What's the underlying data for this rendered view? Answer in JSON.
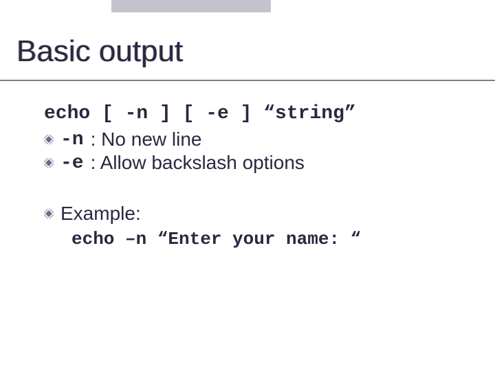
{
  "title": "Basic output",
  "syntax_line": "echo [ -n ] [ -e ] “string”",
  "bullets": [
    {
      "code": "-n",
      "text": ": No new line"
    },
    {
      "code": "-e",
      "text": ": Allow backslash options"
    }
  ],
  "example_label": "Example:",
  "example_code": "echo –n “Enter your name: “"
}
